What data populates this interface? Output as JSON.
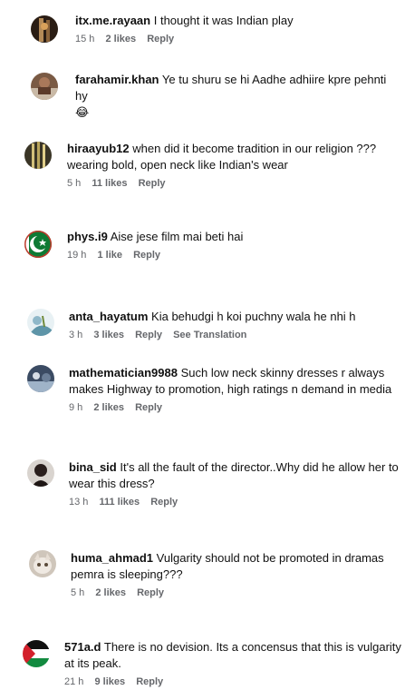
{
  "comments": [
    {
      "username": "itx.me.rayaan",
      "text": "I thought it was Indian play",
      "time": "15 h",
      "likes": "2 likes",
      "reply": "Reply"
    },
    {
      "username": "farahamir.khan",
      "text": "Ye tu shuru se hi Aadhe adhiire kpre pehnti hy",
      "emoji": "😂"
    },
    {
      "username": "hiraayub12",
      "text": "when did it become tradition in our religion ??? wearing bold, open neck like Indian's wear",
      "time": "5 h",
      "likes": "11 likes",
      "reply": "Reply"
    },
    {
      "username": "phys.i9",
      "text": "Aise jese film mai beti hai",
      "time": "19 h",
      "likes": "1 like",
      "reply": "Reply"
    },
    {
      "username": "anta_hayatum",
      "text": "Kia behudgi h koi puchny wala he nhi h",
      "time": "3 h",
      "likes": "3 likes",
      "reply": "Reply",
      "translate": "See Translation"
    },
    {
      "username": "mathematician9988",
      "text": "Such low neck skinny dresses r always makes Highway to promotion, high ratings n demand in media",
      "time": "9 h",
      "likes": "2 likes",
      "reply": "Reply"
    },
    {
      "username": "bina_sid",
      "text": "It's all the fault of the director..Why did he allow her to wear this dress?",
      "time": "13 h",
      "likes": "111 likes",
      "reply": "Reply"
    },
    {
      "username": "huma_ahmad1",
      "text": "Vulgarity should not be promoted in dramas pemra is sleeping???",
      "time": "5 h",
      "likes": "2 likes",
      "reply": "Reply"
    },
    {
      "username": "571a.d",
      "text": "There is no devision. Its a concensus that this is vulgarity at its peak.",
      "time": "21 h",
      "likes": "9 likes",
      "reply": "Reply"
    }
  ]
}
